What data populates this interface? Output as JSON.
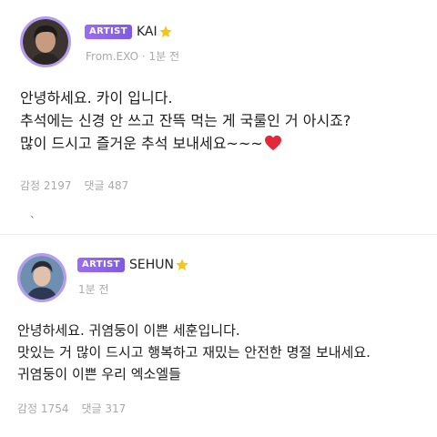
{
  "posts": [
    {
      "badge": "ARTIST",
      "name": "KAI",
      "source": "From.EXO",
      "separator": "·",
      "time": "1분 전",
      "lines": [
        "안녕하세요. 카이 입니다.",
        "추석에는 신경 안 쓰고 잔뜩 먹는 게 국룰인 거 아시죠?",
        "많이 드시고 즐거운 추석 보내세요~~~"
      ],
      "likes_label": "감정",
      "likes": "2197",
      "comments_label": "댓글",
      "comments": "487"
    },
    {
      "badge": "ARTIST",
      "name": "SEHUN",
      "time": "1분 전",
      "lines": [
        "안녕하세요. 귀염둥이 이쁜 세훈입니다.",
        "맛있는 거 많이 드시고 행복하고 재밌는 안전한 명절 보내세요.",
        "귀염둥이 이쁜 우리 엑소엘들"
      ],
      "likes_label": "감정",
      "likes": "1754",
      "comments_label": "댓글",
      "comments": "317"
    }
  ],
  "marker": "ˋ",
  "colors": {
    "badge": "#8a63ec",
    "star": "#f5c518",
    "heart": "#e3283b",
    "muted": "#a9a9a9"
  },
  "icons": {
    "star": "star-icon",
    "heart": "heart-icon"
  }
}
